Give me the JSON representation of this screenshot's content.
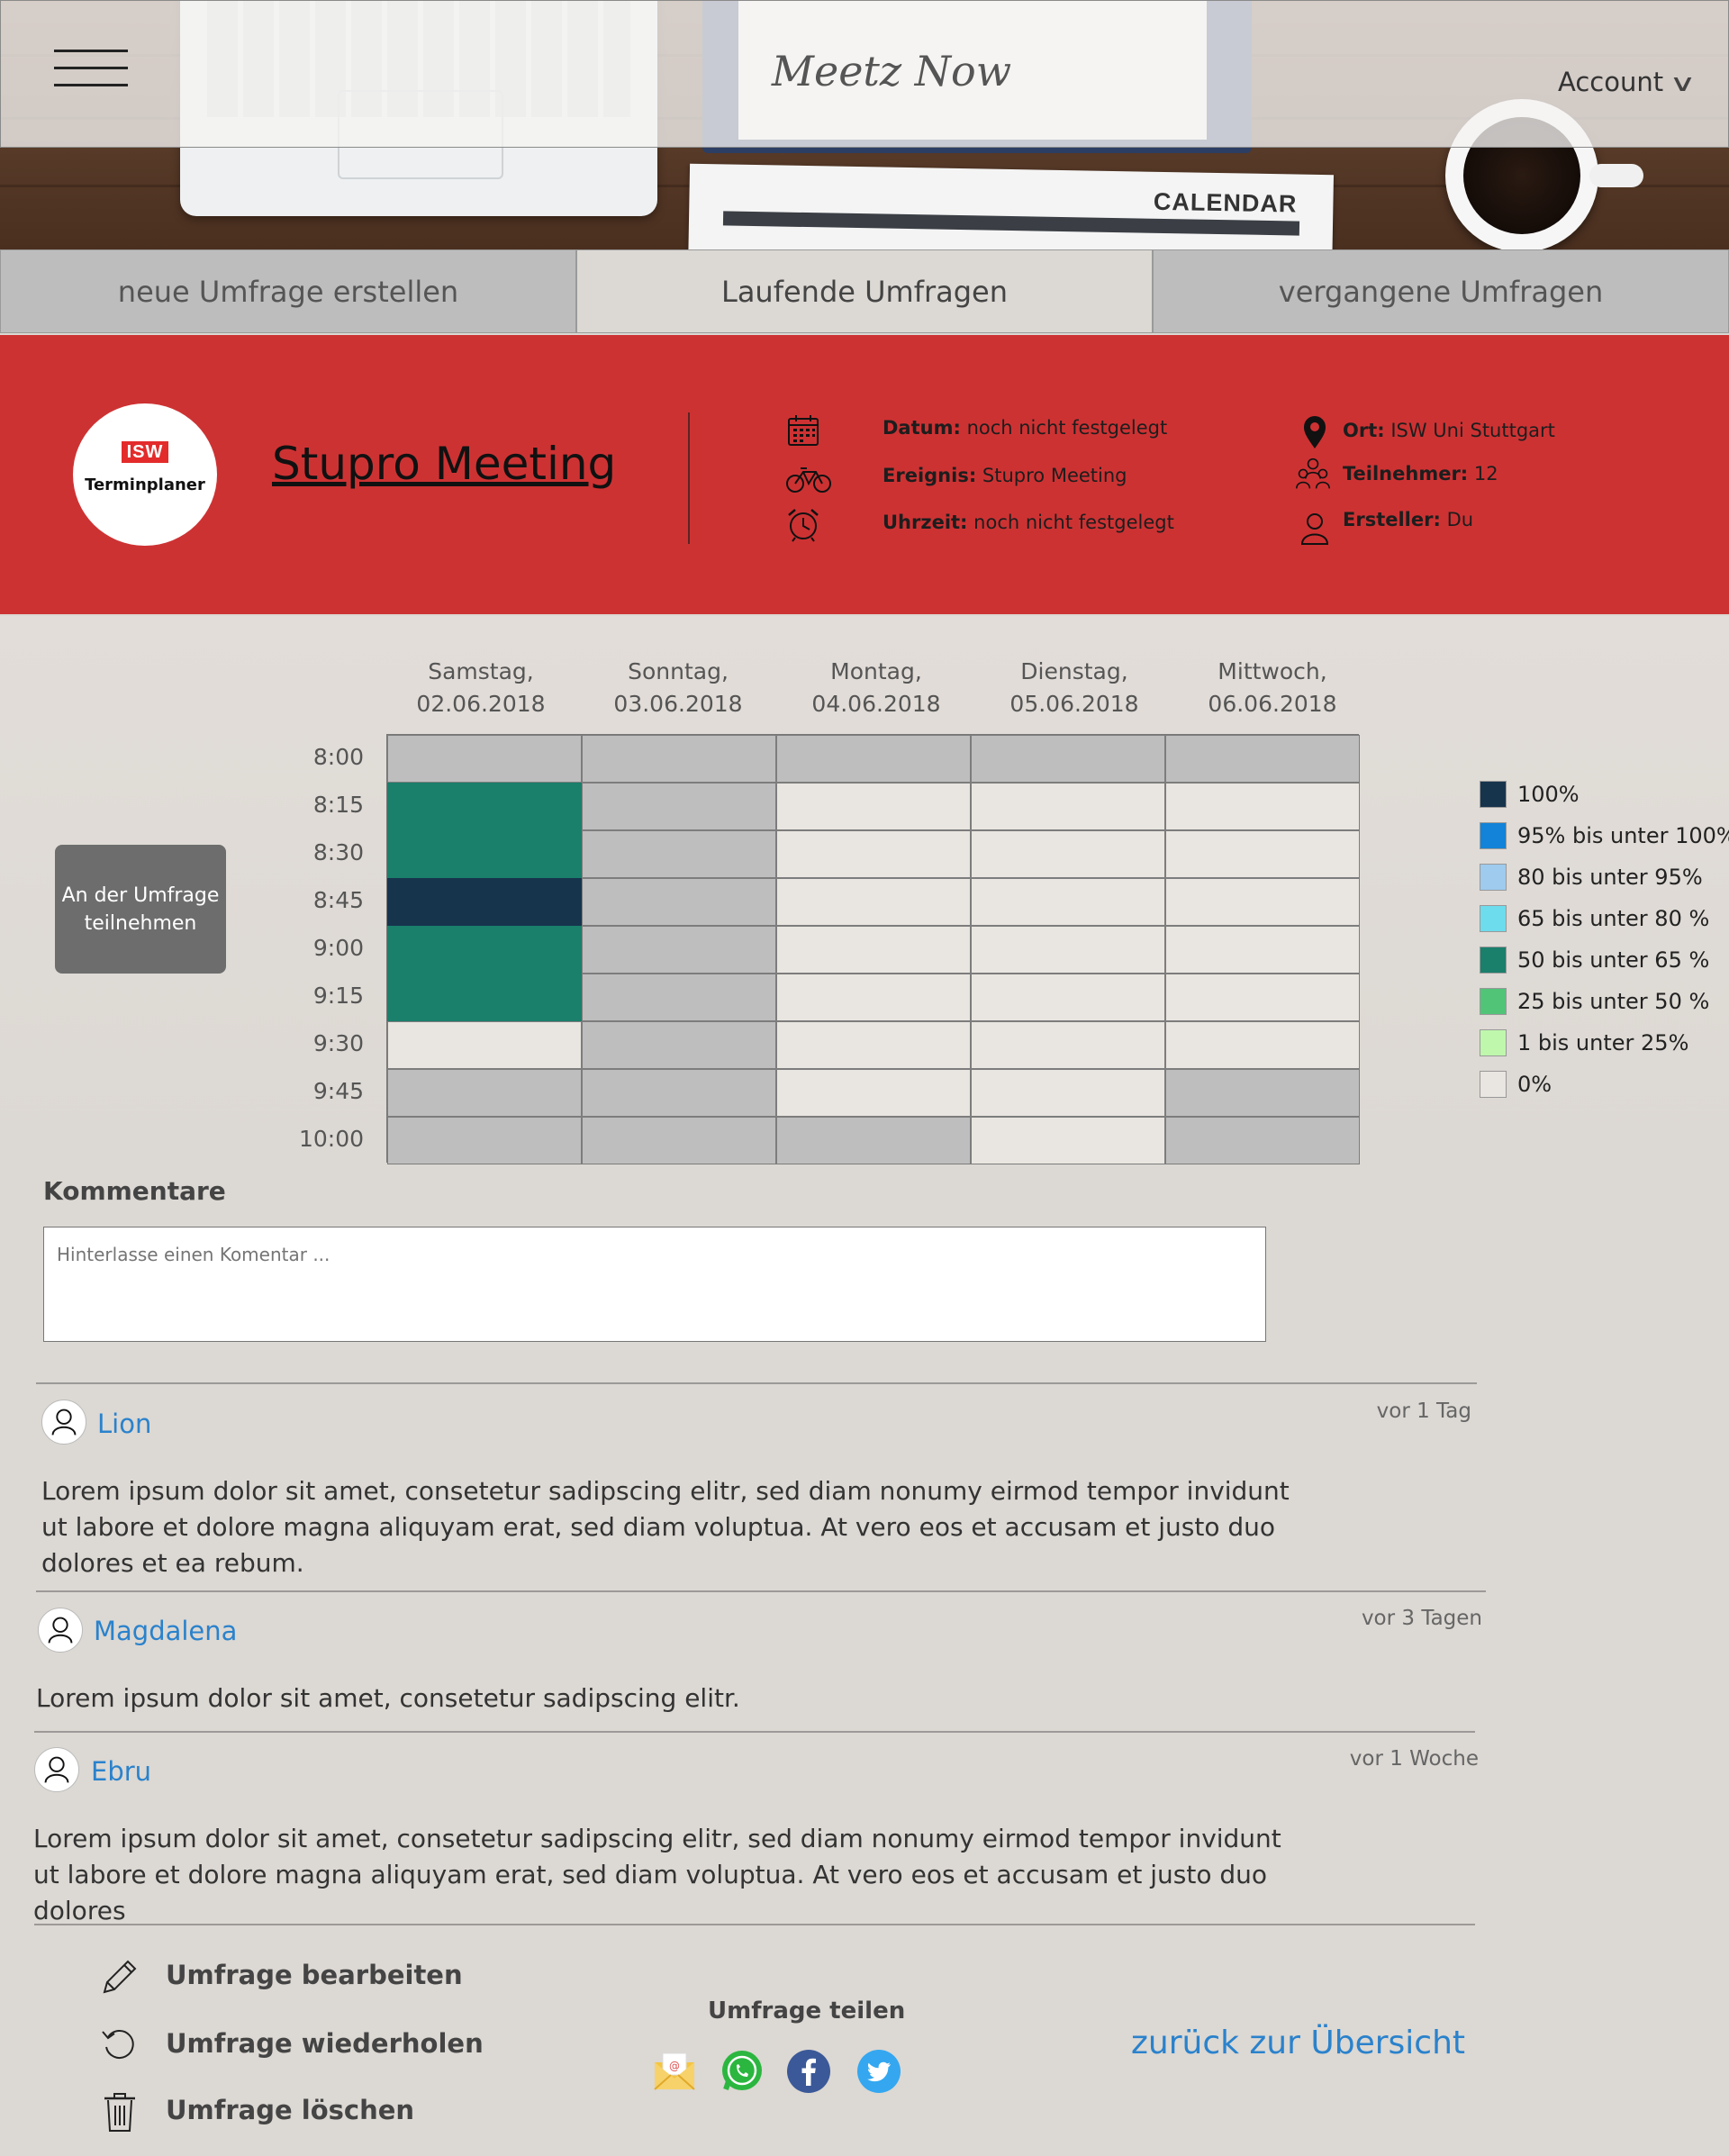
{
  "header": {
    "logo": "Meetz Now",
    "account_label": "Account",
    "photo_caption": "CALENDAR"
  },
  "tabs": [
    {
      "label": "neue Umfrage erstellen",
      "active": false
    },
    {
      "label": "Laufende Umfragen",
      "active": true
    },
    {
      "label": "vergangene Umfragen",
      "active": false
    }
  ],
  "poll": {
    "logo_mark": "ISW",
    "logo_text": "Terminplaner",
    "title": "Stupro Meeting",
    "details": {
      "datum_label": "Datum:",
      "datum_value": "noch nicht festgelegt",
      "ereignis_label": "Ereignis:",
      "ereignis_value": "Stupro Meeting",
      "uhrzeit_label": "Uhrzeit:",
      "uhrzeit_value": "noch nicht festgelegt",
      "ort_label": "Ort:",
      "ort_value": "ISW Uni Stuttgart",
      "teilnehmer_label": "Teilnehmer:",
      "teilnehmer_value": "12",
      "ersteller_label": "Ersteller:",
      "ersteller_value": "Du"
    },
    "join_button": "An der Umfrage teilnehmen"
  },
  "schedule": {
    "days": [
      {
        "name": "Samstag,",
        "date": "02.06.2018"
      },
      {
        "name": "Sonntag,",
        "date": "03.06.2018"
      },
      {
        "name": "Montag,",
        "date": "04.06.2018"
      },
      {
        "name": "Dienstag,",
        "date": "05.06.2018"
      },
      {
        "name": "Mittwoch,",
        "date": "06.06.2018"
      }
    ],
    "times": [
      "8:00",
      "8:15",
      "8:30",
      "8:45",
      "9:00",
      "9:15",
      "9:30",
      "9:45",
      "10:00"
    ],
    "cells": [
      [
        "unavailable",
        "unavailable",
        "unavailable",
        "unavailable",
        "unavailable"
      ],
      [
        "50-65",
        "unavailable",
        "0",
        "0",
        "0"
      ],
      [
        "50-65",
        "unavailable",
        "0",
        "0",
        "0"
      ],
      [
        "100",
        "unavailable",
        "0",
        "0",
        "0"
      ],
      [
        "50-65",
        "unavailable",
        "0",
        "0",
        "0"
      ],
      [
        "50-65",
        "unavailable",
        "0",
        "0",
        "0"
      ],
      [
        "0",
        "unavailable",
        "0",
        "0",
        "0"
      ],
      [
        "unavailable",
        "unavailable",
        "0",
        "0",
        "unavailable"
      ],
      [
        "unavailable",
        "unavailable",
        "unavailable",
        "0",
        "unavailable"
      ]
    ],
    "colors": {
      "100": "#17344d",
      "95-100": "#1283d8",
      "80-95": "#9ecbee",
      "65-80": "#6ddcec",
      "50-65": "#1a7f6b",
      "25-50": "#52c478",
      "1-25": "#bff7ad",
      "0": "#e9e5e0",
      "unavailable": "#bebebe"
    },
    "legend": [
      {
        "key": "100",
        "label": "100%"
      },
      {
        "key": "95-100",
        "label": "95% bis unter 100%"
      },
      {
        "key": "80-95",
        "label": "80 bis unter 95%"
      },
      {
        "key": "65-80",
        "label": "65 bis unter 80 %"
      },
      {
        "key": "50-65",
        "label": "50 bis unter 65 %"
      },
      {
        "key": "25-50",
        "label": "25 bis unter 50 %"
      },
      {
        "key": "1-25",
        "label": "1 bis unter 25%"
      },
      {
        "key": "0",
        "label": "0%"
      }
    ]
  },
  "comments": {
    "title": "Kommentare",
    "placeholder": "Hinterlasse einen Komentar ...",
    "items": [
      {
        "author": "Lion",
        "time": "vor 1 Tag",
        "text": "Lorem ipsum dolor sit amet, consetetur sadipscing elitr, sed diam nonumy eirmod tempor invidunt ut labore et dolore magna aliquyam erat, sed diam voluptua. At vero eos et accusam et justo duo dolores et ea rebum."
      },
      {
        "author": "Magdalena",
        "time": "vor 3 Tagen",
        "text": "Lorem ipsum dolor sit amet, consetetur sadipscing elitr."
      },
      {
        "author": "Ebru",
        "time": "vor 1 Woche",
        "text": "Lorem ipsum dolor sit amet, consetetur sadipscing elitr, sed diam nonumy eirmod tempor invidunt ut labore et dolore magna aliquyam erat, sed diam voluptua. At vero eos et accusam et justo duo dolores"
      }
    ]
  },
  "actions": {
    "edit": "Umfrage bearbeiten",
    "repeat": "Umfrage wiederholen",
    "delete": "Umfrage löschen",
    "share_title": "Umfrage teilen",
    "share_targets": [
      "email-icon",
      "whatsapp-icon",
      "facebook-icon",
      "twitter-icon"
    ],
    "back": "zurück zur Übersicht"
  }
}
